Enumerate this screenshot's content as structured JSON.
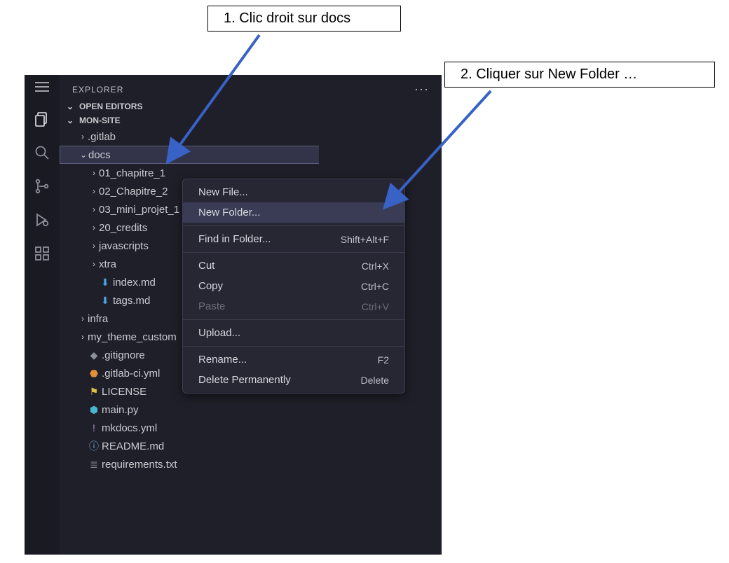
{
  "callouts": {
    "one": "1.   Clic droit sur docs",
    "two": "2.   Cliquer sur New Folder …"
  },
  "sidebar": {
    "title": "EXPLORER",
    "sections": {
      "open_editors": "OPEN EDITORS",
      "workspace": "MON-SITE"
    }
  },
  "tree": {
    "gitlab": ".gitlab",
    "docs": "docs",
    "ch1": "01_chapitre_1",
    "ch2": "02_Chapitre_2",
    "ch3": "03_mini_projet_1",
    "credits": "20_credits",
    "js": "javascripts",
    "xtra": "xtra",
    "index": "index.md",
    "tags": "tags.md",
    "infra": "infra",
    "themecustom": "my_theme_custom",
    "gitignore": ".gitignore",
    "gitlabci": ".gitlab-ci.yml",
    "license": "LICENSE",
    "mainpy": "main.py",
    "mkdocs": "mkdocs.yml",
    "readme": "README.md",
    "requirements": "requirements.txt"
  },
  "menu": {
    "new_file": "New File...",
    "new_folder": "New Folder...",
    "find_in_folder": "Find in Folder...",
    "find_sc": "Shift+Alt+F",
    "cut": "Cut",
    "cut_sc": "Ctrl+X",
    "copy": "Copy",
    "copy_sc": "Ctrl+C",
    "paste": "Paste",
    "paste_sc": "Ctrl+V",
    "upload": "Upload...",
    "rename": "Rename...",
    "rename_sc": "F2",
    "delete": "Delete Permanently",
    "delete_sc": "Delete"
  }
}
